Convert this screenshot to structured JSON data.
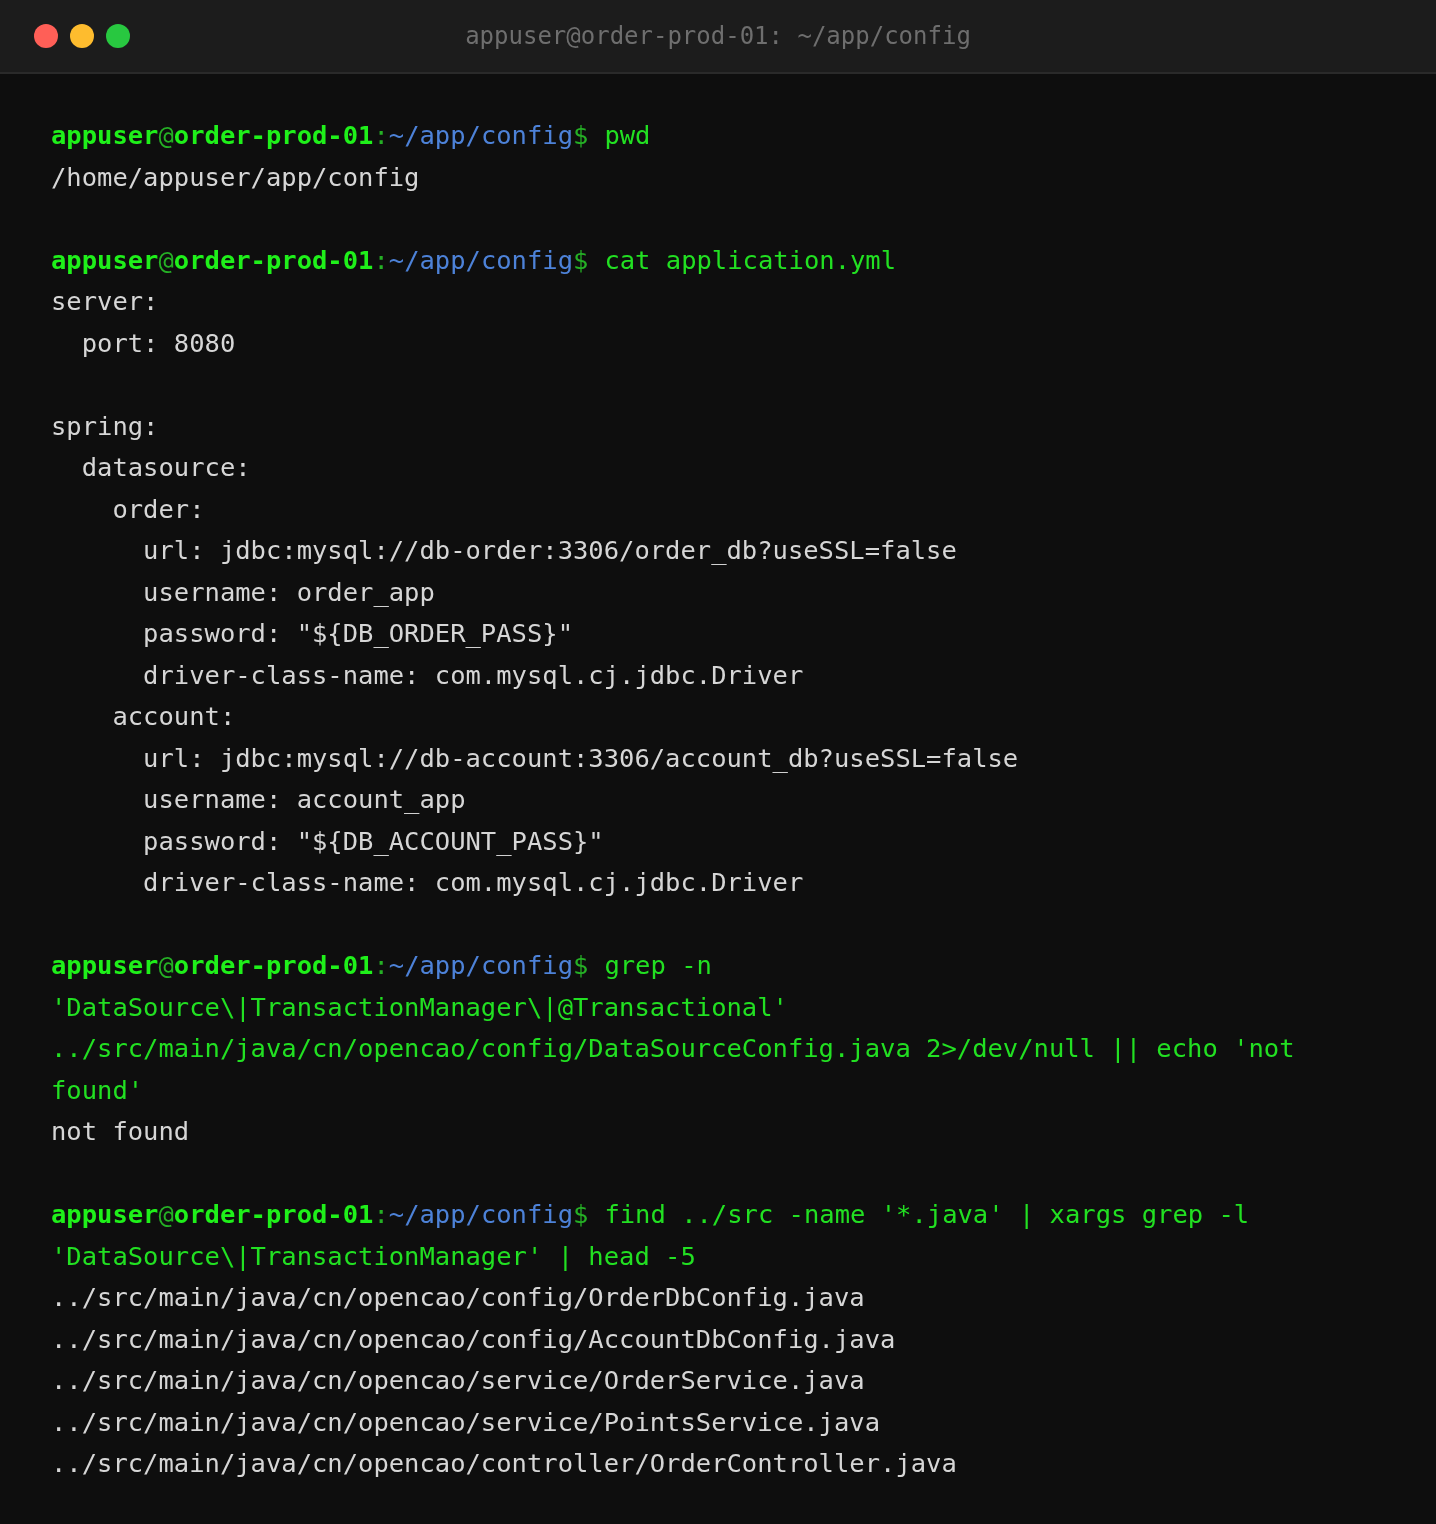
{
  "window": {
    "title": "appuser@order-prod-01: ~/app/config",
    "buttons": [
      {
        "kind": "close"
      },
      {
        "kind": "minimize"
      },
      {
        "kind": "zoom"
      }
    ]
  },
  "session": [
    {
      "prompt": {
        "user": "appuser",
        "at": "@",
        "host": "order-prod-01",
        "sep": ":",
        "path": "~/app/config",
        "sigil": "$"
      },
      "command": [
        "pwd"
      ],
      "output": [
        [
          "/home/appuser/app/config"
        ]
      ]
    },
    {
      "prompt": {
        "user": "appuser",
        "at": "@",
        "host": "order-prod-01",
        "sep": ":",
        "path": "~/app/config",
        "sigil": "$"
      },
      "command": [
        "cat application.yml"
      ],
      "output": [
        [
          "server:",
          "  port: 8080"
        ],
        [
          "spring:",
          "  datasource:",
          "    order:",
          "      url: jdbc:mysql://db-order:3306/order_db?useSSL=false",
          "      username: order_app",
          "      password: \"${DB_ORDER_PASS}\"",
          "      driver-class-name: com.mysql.cj.jdbc.Driver",
          "    account:",
          "      url: jdbc:mysql://db-account:3306/account_db?useSSL=false",
          "      username: account_app",
          "      password: \"${DB_ACCOUNT_PASS}\"",
          "      driver-class-name: com.mysql.cj.jdbc.Driver"
        ]
      ]
    },
    {
      "prompt": {
        "user": "appuser",
        "at": "@",
        "host": "order-prod-01",
        "sep": ":",
        "path": "~/app/config",
        "sigil": "$"
      },
      "command": [
        "grep -n",
        "'DataSource\\|TransactionManager\\|@Transactional'",
        "../src/main/java/cn/opencao/config/DataSourceConfig.java 2>/dev/null || echo 'not",
        "found'"
      ],
      "output": [
        [
          "not found"
        ]
      ]
    },
    {
      "prompt": {
        "user": "appuser",
        "at": "@",
        "host": "order-prod-01",
        "sep": ":",
        "path": "~/app/config",
        "sigil": "$"
      },
      "command": [
        "find ../src -name '*.java' | xargs grep -l",
        "'DataSource\\|TransactionManager' | head -5"
      ],
      "output": [
        [
          "../src/main/java/cn/opencao/config/OrderDbConfig.java",
          "../src/main/java/cn/opencao/config/AccountDbConfig.java",
          "../src/main/java/cn/opencao/service/OrderService.java",
          "../src/main/java/cn/opencao/service/PointsService.java",
          "../src/main/java/cn/opencao/controller/OrderController.java"
        ]
      ]
    }
  ]
}
